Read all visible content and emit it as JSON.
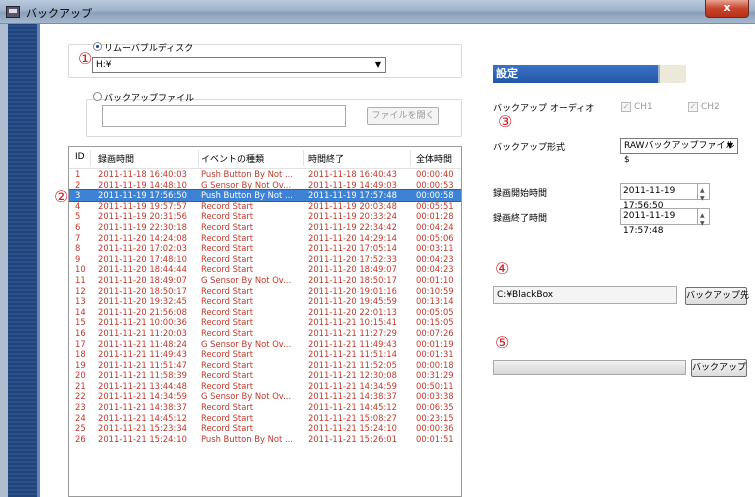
{
  "window": {
    "title": "バックアップ",
    "close_label": "x"
  },
  "source": {
    "removable_disk": {
      "label": "リムーバブルディスク",
      "drive_value": "H:¥"
    },
    "backup_file": {
      "label": "バックアップファイル",
      "path_value": "",
      "open_button": "ファイルを開く"
    }
  },
  "markers": {
    "m1": "①",
    "m2": "②",
    "m3": "③",
    "m4": "④",
    "m5": "⑤"
  },
  "list": {
    "columns": [
      "ID",
      "録画時間",
      "イベントの種類",
      "時間終了",
      "全体時間"
    ],
    "selected_index": 2,
    "rows": [
      [
        "1",
        "2011-11-18 16:40:03",
        "Push Button By Not ...",
        "2011-11-18 16:40:43",
        "00:00:40"
      ],
      [
        "2",
        "2011-11-19 14:48:10",
        "G Sensor By Not Ov...",
        "2011-11-19 14:49:03",
        "00:00:53"
      ],
      [
        "3",
        "2011-11-19 17:56:50",
        "Push Button By Not ...",
        "2011-11-19 17:57:48",
        "00:00:58"
      ],
      [
        "4",
        "2011-11-19 19:57:57",
        "Record Start",
        "2011-11-19 20:03:48",
        "00:05:51"
      ],
      [
        "5",
        "2011-11-19 20:31:56",
        "Record Start",
        "2011-11-19 20:33:24",
        "00:01:28"
      ],
      [
        "6",
        "2011-11-19 22:30:18",
        "Record Start",
        "2011-11-19 22:34:42",
        "00:04:24"
      ],
      [
        "7",
        "2011-11-20 14:24:08",
        "Record Start",
        "2011-11-20 14:29:14",
        "00:05:06"
      ],
      [
        "8",
        "2011-11-20 17:02:03",
        "Record Start",
        "2011-11-20 17:05:14",
        "00:03:11"
      ],
      [
        "9",
        "2011-11-20 17:48:10",
        "Record Start",
        "2011-11-20 17:52:33",
        "00:04:23"
      ],
      [
        "10",
        "2011-11-20 18:44:44",
        "Record Start",
        "2011-11-20 18:49:07",
        "00:04:23"
      ],
      [
        "11",
        "2011-11-20 18:49:07",
        "G Sensor By Not Ov...",
        "2011-11-20 18:50:17",
        "00:01:10"
      ],
      [
        "12",
        "2011-11-20 18:50:17",
        "Record Start",
        "2011-11-20 19:01:16",
        "00:10:59"
      ],
      [
        "13",
        "2011-11-20 19:32:45",
        "Record Start",
        "2011-11-20 19:45:59",
        "00:13:14"
      ],
      [
        "14",
        "2011-11-20 21:56:08",
        "Record Start",
        "2011-11-20 22:01:13",
        "00:05:05"
      ],
      [
        "15",
        "2011-11-21 10:00:36",
        "Record Start",
        "2011-11-21 10:15:41",
        "00:15:05"
      ],
      [
        "16",
        "2011-11-21 11:20:03",
        "Record Start",
        "2011-11-21 11:27:29",
        "00:07:26"
      ],
      [
        "17",
        "2011-11-21 11:48:24",
        "G Sensor By Not Ov...",
        "2011-11-21 11:49:43",
        "00:01:19"
      ],
      [
        "18",
        "2011-11-21 11:49:43",
        "Record Start",
        "2011-11-21 11:51:14",
        "00:01:31"
      ],
      [
        "19",
        "2011-11-21 11:51:47",
        "Record Start",
        "2011-11-21 11:52:05",
        "00:00:18"
      ],
      [
        "20",
        "2011-11-21 11:58:39",
        "Record Start",
        "2011-11-21 12:30:08",
        "00:31:29"
      ],
      [
        "21",
        "2011-11-21 13:44:48",
        "Record Start",
        "2011-11-21 14:34:59",
        "00:50:11"
      ],
      [
        "22",
        "2011-11-21 14:34:59",
        "G Sensor By Not Ov...",
        "2011-11-21 14:38:37",
        "00:03:38"
      ],
      [
        "23",
        "2011-11-21 14:38:37",
        "Record Start",
        "2011-11-21 14:45:12",
        "00:06:35"
      ],
      [
        "24",
        "2011-11-21 14:45:12",
        "Record Start",
        "2011-11-21 15:08:27",
        "00:23:15"
      ],
      [
        "25",
        "2011-11-21 15:23:34",
        "Record Start",
        "2011-11-21 15:24:10",
        "00:00:36"
      ],
      [
        "26",
        "2011-11-21 15:24:10",
        "Push Button By Not ...",
        "2011-11-21 15:26:01",
        "00:01:51"
      ]
    ]
  },
  "settings": {
    "header": "設定",
    "audio_label": "バックアップ オーディオ",
    "ch1_label": "CH1",
    "ch2_label": "CH2",
    "format_label": "バックアップ形式",
    "format_value": "RAWバックアップファイル$",
    "start_label": "録画開始時間",
    "start_value": "2011-11-19 17:56:50",
    "end_label": "録画終了時間",
    "end_value": "2011-11-19 17:57:48",
    "dest_path": "C:¥BlackBox",
    "dest_button": "バックアップ先",
    "backup_button": "バックアップ",
    "progress": 0
  }
}
